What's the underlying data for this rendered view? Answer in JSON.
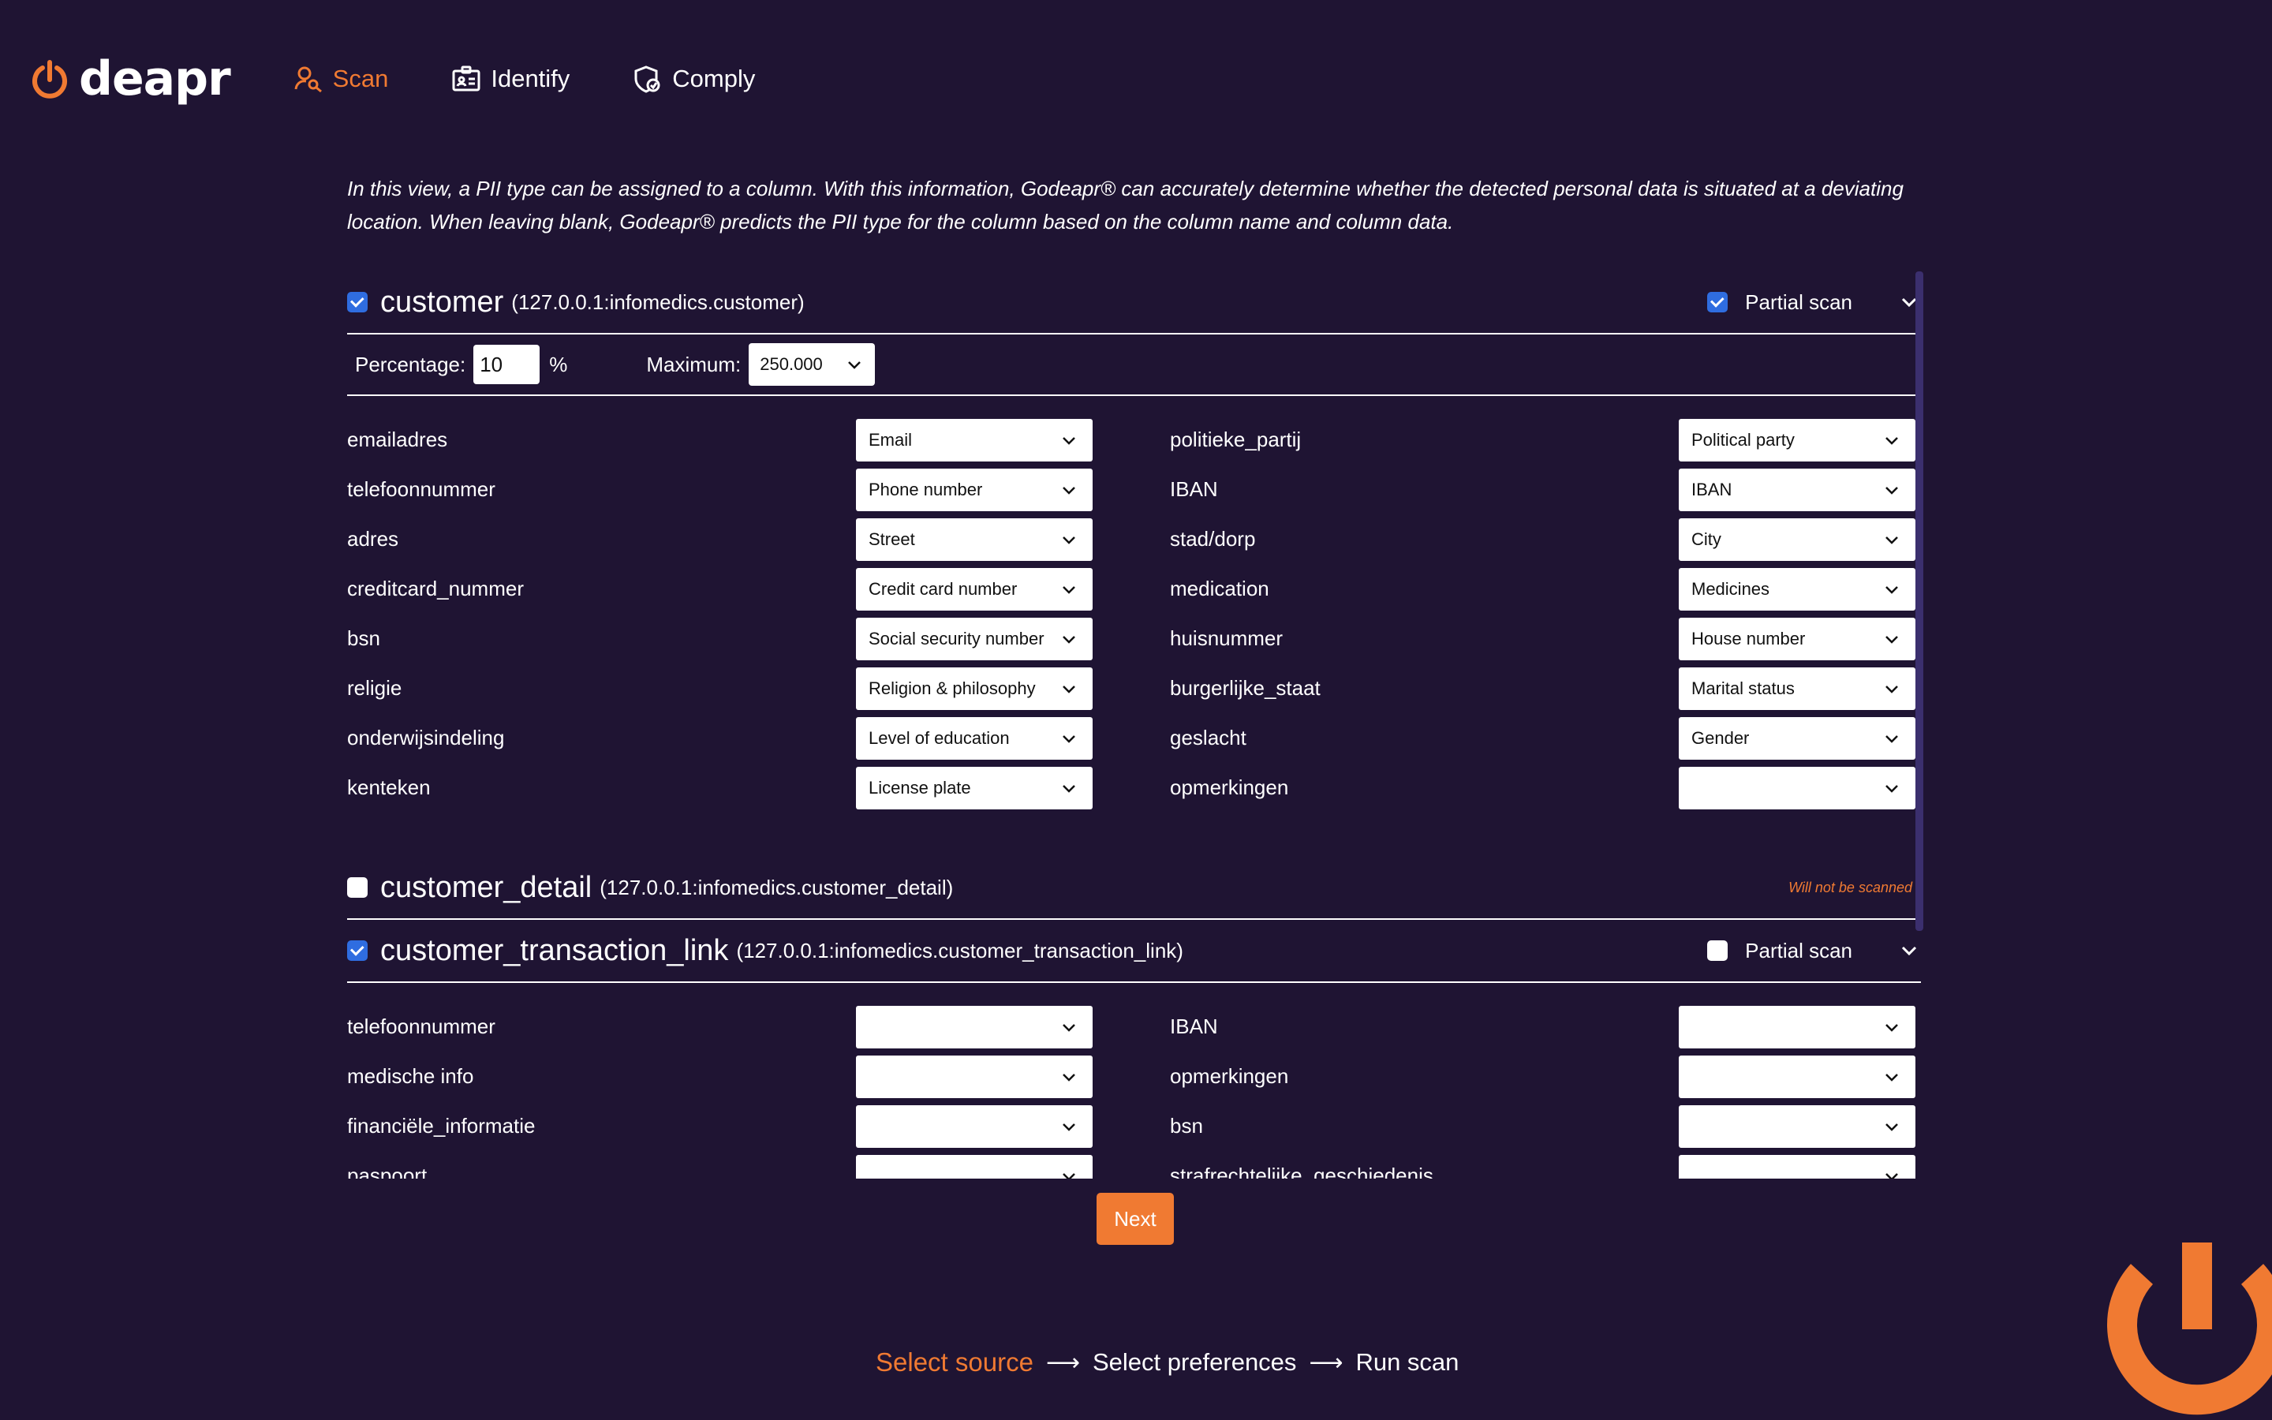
{
  "brand": {
    "name": "deapr",
    "accent": "#f07a32",
    "background": "#1f1433"
  },
  "nav": [
    {
      "label": "Scan",
      "icon": "scan-icon",
      "active": true
    },
    {
      "label": "Identify",
      "icon": "id-card-icon",
      "active": false
    },
    {
      "label": "Comply",
      "icon": "shield-icon",
      "active": false
    }
  ],
  "intro": "In this view, a PII type can be assigned to a column. With this information, Godeapr® can accurately determine whether the detected personal data is situated at a deviating location. When leaving blank, Godeapr® predicts the PII type for the column based on the column name and column data.",
  "tables": {
    "customer": {
      "name": "customer",
      "source": "(127.0.0.1:infomedics.customer)",
      "checked": true,
      "partial_scan_label": "Partial scan",
      "partial_scan": true,
      "percentage_label": "Percentage:",
      "percentage_value": "10",
      "percent_sign": "%",
      "maximum_label": "Maximum:",
      "maximum_value": "250.000",
      "left": [
        {
          "column": "emailadres",
          "pii": "Email"
        },
        {
          "column": "telefoonnummer",
          "pii": "Phone number"
        },
        {
          "column": "adres",
          "pii": "Street"
        },
        {
          "column": "creditcard_nummer",
          "pii": "Credit card number"
        },
        {
          "column": "bsn",
          "pii": "Social security number"
        },
        {
          "column": "religie",
          "pii": "Religion & philosophy"
        },
        {
          "column": "onderwijsindeling",
          "pii": "Level of education"
        },
        {
          "column": "kenteken",
          "pii": "License plate"
        }
      ],
      "right": [
        {
          "column": "politieke_partij",
          "pii": "Political party"
        },
        {
          "column": "IBAN",
          "pii": "IBAN"
        },
        {
          "column": "stad/dorp",
          "pii": "City"
        },
        {
          "column": "medication",
          "pii": "Medicines"
        },
        {
          "column": "huisnummer",
          "pii": "House number"
        },
        {
          "column": "burgerlijke_staat",
          "pii": "Marital status"
        },
        {
          "column": "geslacht",
          "pii": "Gender"
        },
        {
          "column": "opmerkingen",
          "pii": ""
        }
      ]
    },
    "customer_detail": {
      "name": "customer_detail",
      "source": "(127.0.0.1:infomedics.customer_detail)",
      "checked": false,
      "status": "Will not be scanned"
    },
    "customer_transaction_link": {
      "name": "customer_transaction_link",
      "source": "(127.0.0.1:infomedics.customer_transaction_link)",
      "checked": true,
      "partial_scan_label": "Partial scan",
      "partial_scan": false,
      "left": [
        {
          "column": "telefoonnummer",
          "pii": ""
        },
        {
          "column": "medische info",
          "pii": ""
        },
        {
          "column": "financiële_informatie",
          "pii": ""
        },
        {
          "column": "paspoort",
          "pii": ""
        }
      ],
      "right": [
        {
          "column": "IBAN",
          "pii": ""
        },
        {
          "column": "opmerkingen",
          "pii": ""
        },
        {
          "column": "bsn",
          "pii": ""
        },
        {
          "column": "strafrechtelijke_geschiedenis",
          "pii": ""
        }
      ]
    }
  },
  "next_label": "Next",
  "steps": {
    "step1": "Select source",
    "step2": "Select preferences",
    "step3": "Run scan",
    "arrow": "⟶"
  }
}
